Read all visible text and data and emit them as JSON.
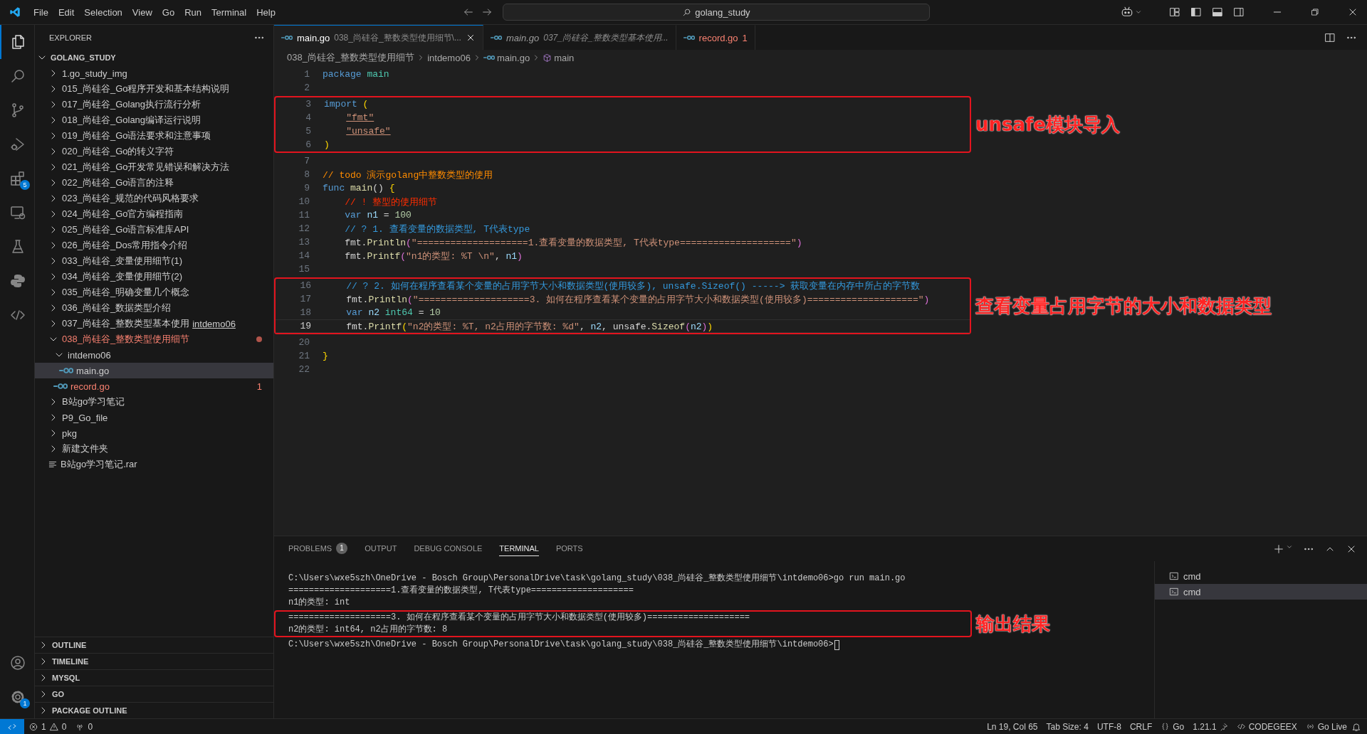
{
  "menu": [
    "File",
    "Edit",
    "Selection",
    "View",
    "Go",
    "Run",
    "Terminal",
    "Help"
  ],
  "command_center": {
    "text": "golang_study"
  },
  "activity_bar": {
    "items": [
      {
        "selected": true
      },
      {
        "selected": false
      },
      {
        "selected": false
      },
      {
        "selected": false
      },
      {
        "selected": false,
        "badge": "5"
      },
      {
        "selected": false
      },
      {
        "selected": false
      },
      {
        "selected": false
      },
      {
        "selected": false
      }
    ],
    "bottom": [
      {
        "selected": false
      },
      {
        "selected": false,
        "badge": "1"
      }
    ]
  },
  "sidebar": {
    "title": "EXPLORER",
    "root": {
      "label": "GOLANG_STUDY",
      "expanded": true
    },
    "tree": [
      {
        "kind": "folder",
        "label": "1.go_study_img",
        "expanded": false,
        "selected": false,
        "problems": false
      },
      {
        "kind": "folder",
        "label": "015_尚硅谷_Go程序开发和基本结构说明",
        "expanded": false,
        "selected": false,
        "problems": false
      },
      {
        "kind": "folder",
        "label": "017_尚硅谷_Golang执行流行分析",
        "expanded": false,
        "selected": false,
        "problems": false
      },
      {
        "kind": "folder",
        "label": "018_尚硅谷_Golang编译运行说明",
        "expanded": false,
        "selected": false,
        "problems": false
      },
      {
        "kind": "folder",
        "label": "019_尚硅谷_Go语法要求和注意事项",
        "expanded": false,
        "selected": false,
        "problems": false
      },
      {
        "kind": "folder",
        "label": "020_尚硅谷_Go的转义字符",
        "expanded": false,
        "selected": false,
        "problems": false
      },
      {
        "kind": "folder",
        "label": "021_尚硅谷_Go开发常见错误和解决方法",
        "expanded": false,
        "selected": false,
        "problems": false
      },
      {
        "kind": "folder",
        "label": "022_尚硅谷_Go语言的注释",
        "expanded": false,
        "selected": false,
        "problems": false
      },
      {
        "kind": "folder",
        "label": "023_尚硅谷_规范的代码风格要求",
        "expanded": false,
        "selected": false,
        "problems": false
      },
      {
        "kind": "folder",
        "label": "024_尚硅谷_Go官方编程指南",
        "expanded": false,
        "selected": false,
        "problems": false
      },
      {
        "kind": "folder",
        "label": "025_尚硅谷_Go语言标准库API",
        "expanded": false,
        "selected": false,
        "problems": false
      },
      {
        "kind": "folder",
        "label": "026_尚硅谷_Dos常用指令介绍",
        "expanded": false,
        "selected": false,
        "problems": false
      },
      {
        "kind": "folder",
        "label": "033_尚硅谷_变量使用细节(1)",
        "expanded": false,
        "selected": false,
        "problems": false
      },
      {
        "kind": "folder",
        "label": "034_尚硅谷_变量使用细节(2)",
        "expanded": false,
        "selected": false,
        "problems": false
      },
      {
        "kind": "folder",
        "label": "035_尚硅谷_明确变量几个概念",
        "expanded": false,
        "selected": false,
        "problems": false
      },
      {
        "kind": "folder",
        "label": "036_尚硅谷_数据类型介绍",
        "expanded": false,
        "selected": false,
        "problems": false
      },
      {
        "kind": "folder",
        "label": "037_尚硅谷_整数类型基本使用",
        "compact": "intdemo06",
        "expanded": false,
        "selected": false,
        "problems": false
      },
      {
        "kind": "folder",
        "label": "038_尚硅谷_整数类型使用细节",
        "expanded": true,
        "selected": false,
        "problems": true,
        "children": [
          {
            "kind": "folder",
            "label": "intdemo06",
            "expanded": true,
            "selected": false,
            "problems": false,
            "children": [
              {
                "kind": "go-file",
                "label": "main.go",
                "selected": true,
                "problems": false
              }
            ]
          },
          {
            "kind": "go-file",
            "label": "record.go",
            "selected": false,
            "problems": true,
            "badge": "1"
          }
        ]
      },
      {
        "kind": "folder",
        "label": "B站go学习笔记",
        "expanded": false,
        "selected": false,
        "problems": false
      },
      {
        "kind": "folder",
        "label": "P9_Go_file",
        "expanded": false,
        "selected": false,
        "problems": false
      },
      {
        "kind": "folder",
        "label": "pkg",
        "expanded": false,
        "selected": false,
        "problems": false
      },
      {
        "kind": "folder",
        "label": "新建文件夹",
        "expanded": false,
        "selected": false,
        "problems": false
      },
      {
        "kind": "other-file",
        "label": "B站go学习笔记.rar",
        "selected": false,
        "problems": false
      }
    ],
    "sections": [
      {
        "label": "OUTLINE",
        "expanded": false
      },
      {
        "label": "TIMELINE",
        "expanded": false
      },
      {
        "label": "MYSQL",
        "expanded": false
      },
      {
        "label": "GO",
        "expanded": false
      },
      {
        "label": "PACKAGE OUTLINE",
        "expanded": false
      }
    ]
  },
  "tabs": [
    {
      "label": "main.go",
      "description": "038_尚硅谷_整数类型使用细节\\...",
      "selected": true,
      "preview": false,
      "problems": false
    },
    {
      "label": "main.go",
      "description": "037_尚硅谷_整数类型基本使用...",
      "selected": false,
      "preview": true,
      "problems": false
    },
    {
      "label": "record.go",
      "badge": "1",
      "selected": false,
      "preview": false,
      "problems": true
    }
  ],
  "breadcrumb": [
    "038_尚硅谷_整数类型使用细节",
    "intdemo06",
    "main.go",
    "main"
  ],
  "editor": {
    "groups": [
      {
        "lines": [
          {
            "n": "1",
            "current": false,
            "tokens": [
              {
                "kind": "keyword",
                "text": "package"
              },
              {
                "kind": "name",
                "text": " main"
              }
            ]
          },
          {
            "n": "2",
            "current": false
          }
        ]
      },
      {
        "annotation": "unsafe模块导入",
        "lines": [
          {
            "n": "3",
            "current": false,
            "tokens": [
              {
                "kind": "keyword",
                "text": "import"
              },
              {
                "kind": "bracket",
                "text": " ("
              }
            ]
          },
          {
            "n": "4",
            "current": false,
            "indented": true,
            "tokens": [
              {
                "kind": "import-path",
                "text": "\"fmt\""
              }
            ]
          },
          {
            "n": "5",
            "current": false,
            "indented": true,
            "tokens": [
              {
                "kind": "import-path",
                "text": "\"unsafe\""
              }
            ]
          },
          {
            "n": "6",
            "current": false,
            "tokens": [
              {
                "kind": "bracket",
                "text": ")"
              }
            ]
          }
        ]
      },
      {
        "lines": [
          {
            "n": "7",
            "current": false
          },
          {
            "n": "8",
            "current": false,
            "tokens": [
              {
                "kind": "comment-todo",
                "text": "// todo 演示golang中整数类型的使用"
              }
            ]
          },
          {
            "n": "9",
            "current": false,
            "tokens": [
              {
                "kind": "keyword",
                "text": "func"
              },
              {
                "kind": "function",
                "text": " main"
              },
              {
                "kind": "plain",
                "text": "() "
              },
              {
                "kind": "bracket",
                "text": "{"
              }
            ]
          },
          {
            "n": "10",
            "current": false,
            "indented": true,
            "tokens": [
              {
                "kind": "comment-alert",
                "text": "// ! 整型的使用细节"
              }
            ]
          },
          {
            "n": "11",
            "current": false,
            "indented": true,
            "tokens": [
              {
                "kind": "keyword",
                "text": "var"
              },
              {
                "kind": "variable",
                "text": " n1"
              },
              {
                "kind": "plain",
                "text": " = "
              },
              {
                "kind": "number",
                "text": "100"
              }
            ]
          },
          {
            "n": "12",
            "current": false,
            "indented": true,
            "tokens": [
              {
                "kind": "comment-query",
                "text": "// ? 1. 查看变量的数据类型, T代表type"
              }
            ]
          },
          {
            "n": "13",
            "current": false,
            "indented": true,
            "tokens": [
              {
                "kind": "plain",
                "text": "fmt."
              },
              {
                "kind": "function",
                "text": "Println"
              },
              {
                "kind": "bracket2",
                "text": "("
              },
              {
                "kind": "string",
                "text": "\"====================1.查看变量的数据类型, T代表type====================\""
              },
              {
                "kind": "bracket2",
                "text": ")"
              }
            ]
          },
          {
            "n": "14",
            "current": false,
            "indented": true,
            "tokens": [
              {
                "kind": "plain",
                "text": "fmt."
              },
              {
                "kind": "function",
                "text": "Printf"
              },
              {
                "kind": "bracket2",
                "text": "("
              },
              {
                "kind": "string",
                "text": "\"n1的类型: %T \\n\""
              },
              {
                "kind": "plain",
                "text": ", "
              },
              {
                "kind": "variable",
                "text": "n1"
              },
              {
                "kind": "bracket2",
                "text": ")"
              }
            ]
          },
          {
            "n": "15",
            "current": false
          }
        ]
      },
      {
        "annotation": "查看变量占用字节的大小和数据类型",
        "lines": [
          {
            "n": "16",
            "current": false,
            "indented": true,
            "tokens": [
              {
                "kind": "comment-query",
                "text": "// ? 2. 如何在程序查看某个变量的占用字节大小和数据类型(使用较多), unsafe.Sizeof() -----> 获取变量在内存中所占的字节数"
              }
            ]
          },
          {
            "n": "17",
            "current": false,
            "indented": true,
            "tokens": [
              {
                "kind": "plain",
                "text": "fmt."
              },
              {
                "kind": "function",
                "text": "Println"
              },
              {
                "kind": "bracket2",
                "text": "("
              },
              {
                "kind": "string",
                "text": "\"====================3. 如何在程序查看某个变量的占用字节大小和数据类型(使用较多)====================\""
              },
              {
                "kind": "bracket2",
                "text": ")"
              }
            ]
          },
          {
            "n": "18",
            "current": false,
            "indented": true,
            "tokens": [
              {
                "kind": "keyword",
                "text": "var"
              },
              {
                "kind": "variable",
                "text": " n2"
              },
              {
                "kind": "type",
                "text": " int64"
              },
              {
                "kind": "plain",
                "text": " = "
              },
              {
                "kind": "number",
                "text": "10"
              }
            ]
          },
          {
            "n": "19",
            "current": true,
            "indented": true,
            "tokens": [
              {
                "kind": "plain",
                "text": "fmt."
              },
              {
                "kind": "function",
                "text": "Printf"
              },
              {
                "kind": "bracket",
                "text": "("
              },
              {
                "kind": "string",
                "text": "\"n2的类型: %T, n2占用的字节数: %d\""
              },
              {
                "kind": "plain",
                "text": ", "
              },
              {
                "kind": "variable",
                "text": "n2"
              },
              {
                "kind": "plain",
                "text": ", unsafe."
              },
              {
                "kind": "function",
                "text": "Sizeof"
              },
              {
                "kind": "bracket2",
                "text": "("
              },
              {
                "kind": "variable",
                "text": "n2"
              },
              {
                "kind": "bracket2",
                "text": ")"
              },
              {
                "kind": "bracket",
                "text": ")"
              }
            ]
          }
        ]
      },
      {
        "lines": [
          {
            "n": "20",
            "current": false
          },
          {
            "n": "21",
            "current": false,
            "tokens": [
              {
                "kind": "bracket",
                "text": "}"
              }
            ]
          },
          {
            "n": "22",
            "current": false
          }
        ]
      }
    ]
  },
  "panel": {
    "tabs": [
      {
        "label": "PROBLEMS",
        "badge": "1",
        "selected": false
      },
      {
        "label": "OUTPUT",
        "selected": false
      },
      {
        "label": "DEBUG CONSOLE",
        "selected": false
      },
      {
        "label": "TERMINAL",
        "selected": true
      },
      {
        "label": "PORTS",
        "selected": false
      }
    ],
    "terminal": {
      "groups": [
        {
          "lines": [
            "C:\\Users\\wxe5szh\\OneDrive - Bosch Group\\PersonalDrive\\task\\golang_study\\038_尚硅谷_整数类型使用细节\\intdemo06>go run main.go",
            "====================1.查看变量的数据类型, T代表type====================",
            "n1的类型: int"
          ]
        },
        {
          "annotation": "输出结果",
          "lines": [
            "====================3. 如何在程序查看某个变量的占用字节大小和数据类型(使用较多)====================",
            "n2的类型: int64, n2占用的字节数: 8"
          ]
        },
        {
          "lines": [
            "C:\\Users\\wxe5szh\\OneDrive - Bosch Group\\PersonalDrive\\task\\golang_study\\038_尚硅谷_整数类型使用细节\\intdemo06>"
          ],
          "cursor": true
        }
      ]
    },
    "terminals": [
      {
        "label": "cmd",
        "selected": false
      },
      {
        "label": "cmd",
        "selected": true
      }
    ]
  },
  "status_bar": {
    "errors": "1",
    "warnings": "0",
    "ports": "0",
    "items": [
      "Ln 19, Col 65",
      "Tab Size: 4",
      "UTF-8",
      "CRLF",
      "Go",
      "1.21.1",
      "CODEGEEX",
      "Go Live"
    ]
  }
}
